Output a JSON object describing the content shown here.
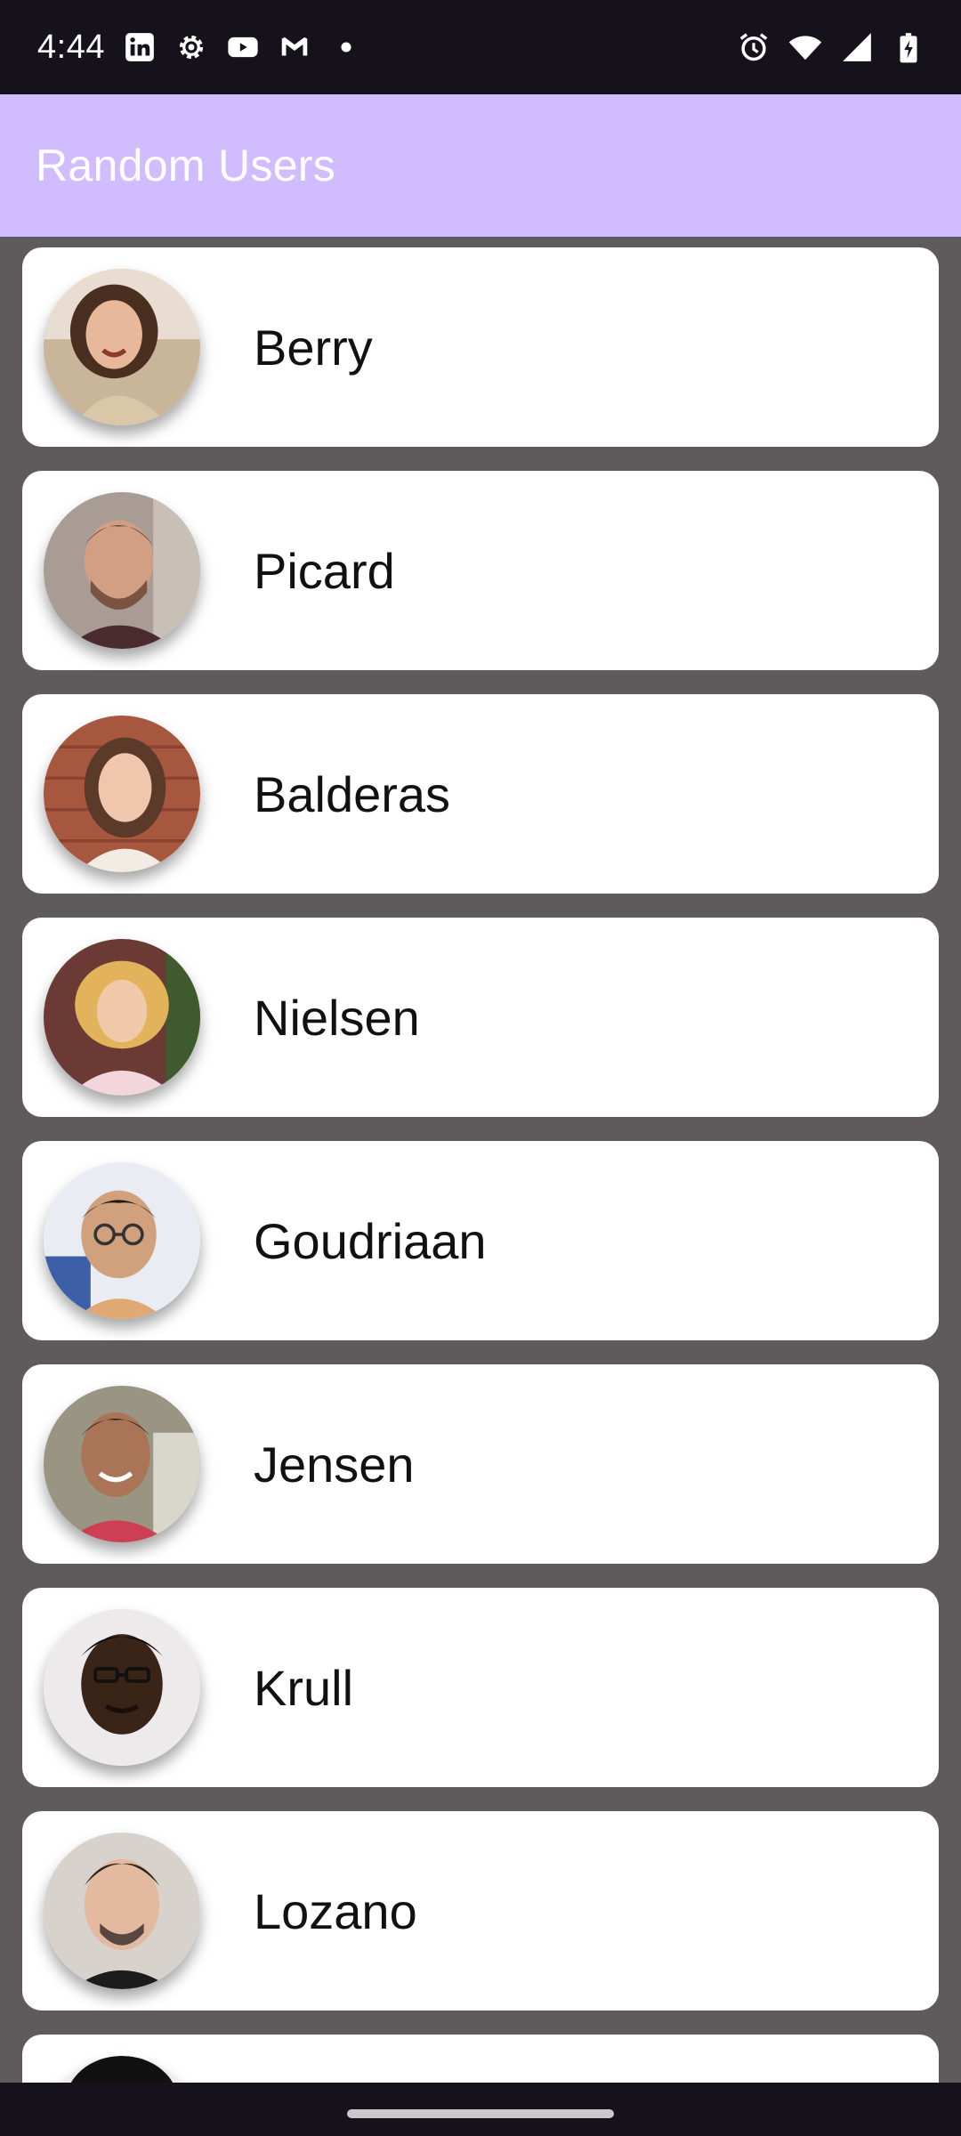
{
  "status_bar": {
    "time": "4:44",
    "left_icons": [
      "linkedin-icon",
      "settings-gear-icon",
      "youtube-icon",
      "gmail-icon",
      "dot-icon"
    ],
    "right_icons": [
      "alarm-icon",
      "wifi-icon",
      "signal-icon",
      "battery-charging-icon"
    ]
  },
  "app_bar": {
    "title": "Random Users",
    "color": "#d0bcff"
  },
  "users": [
    {
      "name": "Berry",
      "avatar": "user-photo"
    },
    {
      "name": "Picard",
      "avatar": "user-photo"
    },
    {
      "name": "Balderas",
      "avatar": "user-photo"
    },
    {
      "name": "Nielsen",
      "avatar": "user-photo"
    },
    {
      "name": "Goudriaan",
      "avatar": "user-photo"
    },
    {
      "name": "Jensen",
      "avatar": "user-photo"
    },
    {
      "name": "Krull",
      "avatar": "user-photo"
    },
    {
      "name": "Lozano",
      "avatar": "user-photo"
    }
  ],
  "colors": {
    "status_bar_bg": "#15121b",
    "list_bg": "#5f5a5b",
    "card_bg": "#ffffff"
  }
}
